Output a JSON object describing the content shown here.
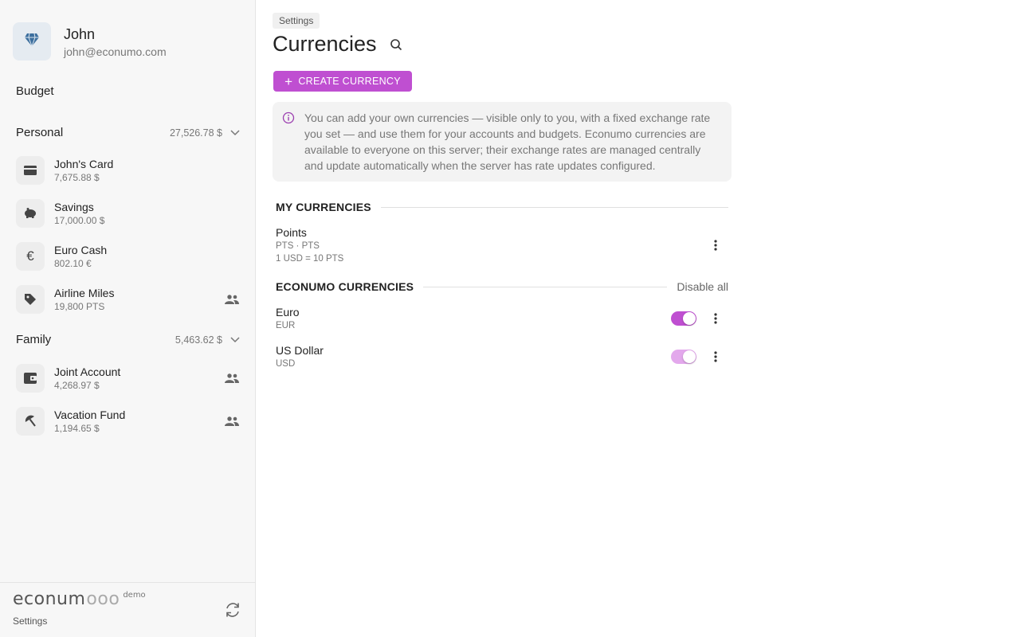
{
  "user": {
    "name": "John",
    "email": "john@econumo.com"
  },
  "sidebar": {
    "budget_label": "Budget",
    "folders": [
      {
        "name": "Personal",
        "total": "27,526.78 $",
        "accounts": [
          {
            "name": "John's Card",
            "balance": "7,675.88 $",
            "icon": "credit-card-icon",
            "shared": false
          },
          {
            "name": "Savings",
            "balance": "17,000.00 $",
            "icon": "piggy-bank-icon",
            "shared": false
          },
          {
            "name": "Euro Cash",
            "balance": "802.10 €",
            "icon": "euro-icon",
            "shared": false
          },
          {
            "name": "Airline Miles",
            "balance": "19,800 PTS",
            "icon": "tag-icon",
            "shared": true
          }
        ]
      },
      {
        "name": "Family",
        "total": "5,463.62 $",
        "accounts": [
          {
            "name": "Joint Account",
            "balance": "4,268.97 $",
            "icon": "wallet-icon",
            "shared": true
          },
          {
            "name": "Vacation Fund",
            "balance": "1,194.65 $",
            "icon": "umbrella-icon",
            "shared": true
          }
        ]
      }
    ],
    "footer": {
      "logo": "econum",
      "logo_suffix": "ooo",
      "demo_badge": "demo",
      "settings_label": "Settings"
    }
  },
  "main": {
    "breadcrumb": "Settings",
    "title": "Currencies",
    "create_button": "CREATE CURRENCY",
    "info_text": "You can add your own currencies — visible only to you, with a fixed exchange rate you set — and use them for your accounts and budgets. Econumo currencies are available to everyone on this server; their exchange rates are managed centrally and update automatically when the server has rate updates configured.",
    "my_currencies": {
      "title": "MY CURRENCIES",
      "items": [
        {
          "name": "Points",
          "code": "PTS · PTS",
          "rate": "1 USD = 10 PTS"
        }
      ]
    },
    "econumo_currencies": {
      "title": "ECONUMO CURRENCIES",
      "disable_all": "Disable all",
      "items": [
        {
          "name": "Euro",
          "code": "EUR",
          "enabled": true
        },
        {
          "name": "US Dollar",
          "code": "USD",
          "enabled": true
        }
      ]
    }
  },
  "colors": {
    "accent": "#bf4fd1",
    "accent_light": "#e3a8ec",
    "sidebar_bg": "#f7f7f7",
    "info_bg": "#f3f3f3"
  }
}
